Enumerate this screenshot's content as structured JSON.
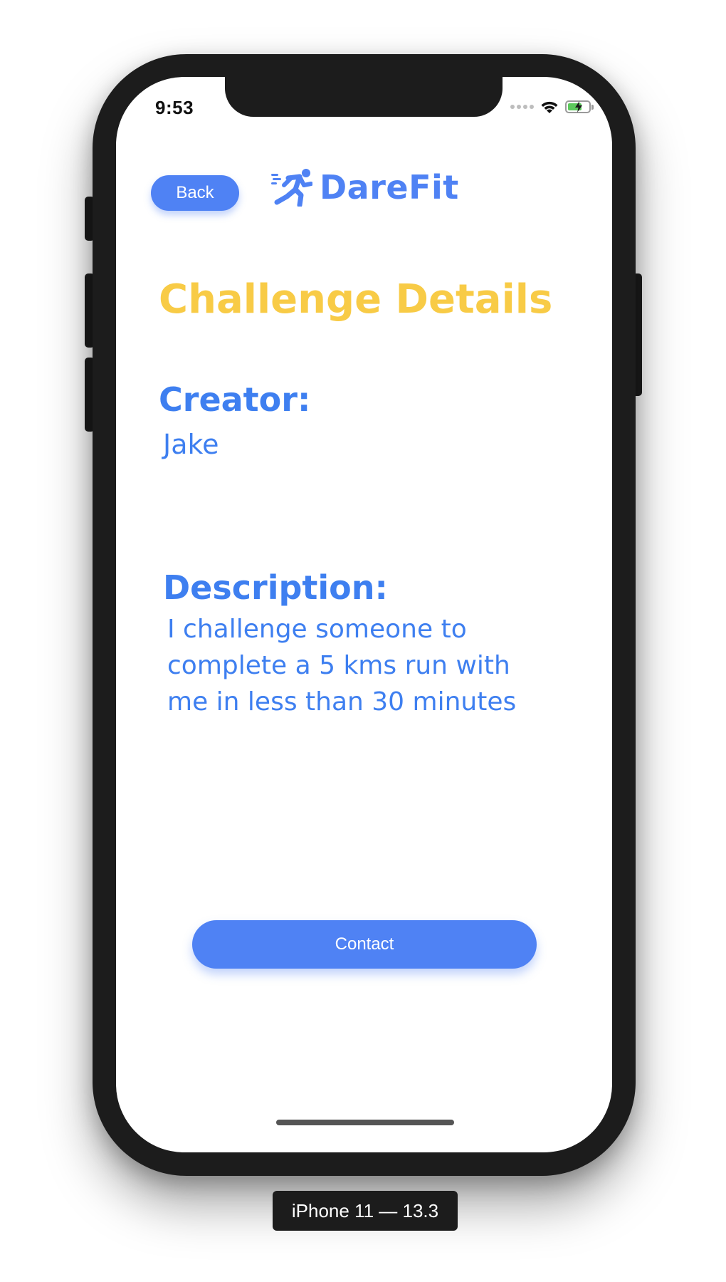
{
  "status_bar": {
    "time": "9:53",
    "icons": [
      "cellular-signal-icon",
      "wifi-icon",
      "battery-charging-icon"
    ]
  },
  "header": {
    "back_label": "Back",
    "logo_text": "DareFit",
    "logo_icon": "runner-icon"
  },
  "main": {
    "title": "Challenge Details",
    "creator_label": "Creator:",
    "creator_name": "Jake",
    "description_label": "Description:",
    "description_text": "I challenge someone to complete a 5 kms run with me in less than 30 minutes",
    "contact_label": "Contact"
  },
  "device": {
    "label": "iPhone 11 — 13.3"
  },
  "colors": {
    "accent_blue": "#4f82f4",
    "text_blue": "#3e7ff0",
    "title_yellow": "#f8cb46",
    "device_frame": "#1c1c1c"
  }
}
